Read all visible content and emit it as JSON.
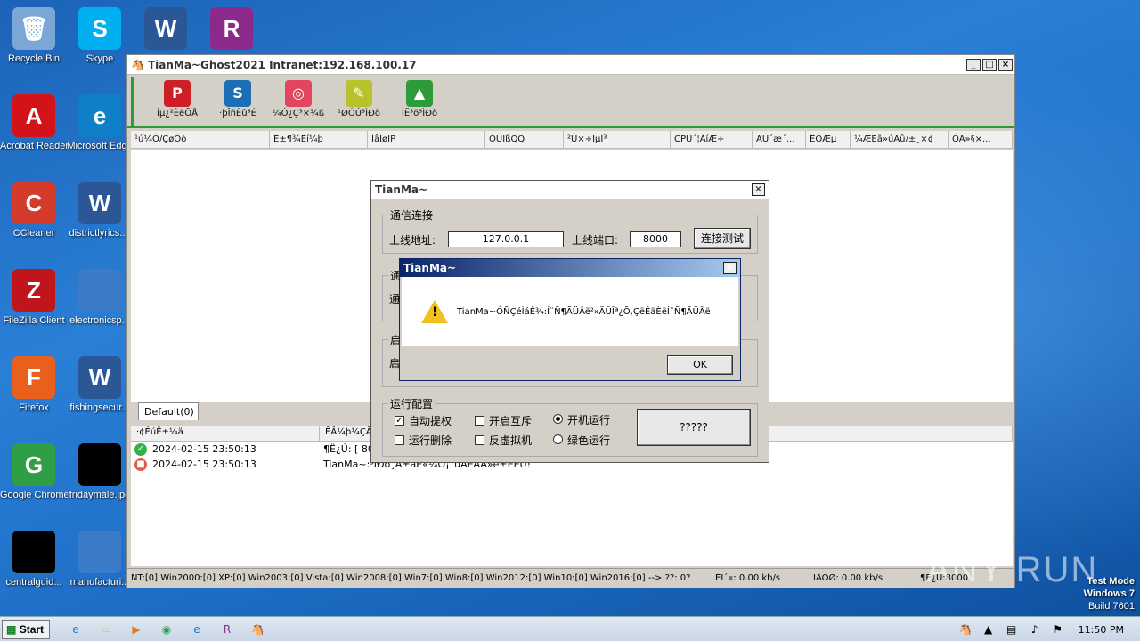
{
  "desktop": {
    "icons": [
      {
        "label": "Recycle Bin",
        "icon": "recycle-bin-icon",
        "color": "#7aa7d6",
        "glyph": "🗑"
      },
      {
        "label": "Skype",
        "icon": "skype-icon",
        "color": "#00aff0",
        "glyph": "S"
      },
      {
        "label": "",
        "icon": "word-doc-icon",
        "color": "#2b5797",
        "glyph": "W"
      },
      {
        "label": "",
        "icon": "winrar-icon",
        "color": "#8b2a8a",
        "glyph": "R"
      },
      {
        "label": "Acrobat Reader DC",
        "icon": "acrobat-icon",
        "color": "#d4121a",
        "glyph": "A"
      },
      {
        "label": "Microsoft Edge",
        "icon": "edge-icon",
        "color": "#0f7fc8",
        "glyph": "e"
      },
      {
        "label": "CCleaner",
        "icon": "ccleaner-icon",
        "color": "#d43b2a",
        "glyph": "C"
      },
      {
        "label": "districtlyrics....",
        "icon": "word-doc-icon",
        "color": "#2b5797",
        "glyph": "W"
      },
      {
        "label": "FileZilla Client",
        "icon": "filezilla-icon",
        "color": "#c0151b",
        "glyph": "Z"
      },
      {
        "label": "electronicsp...",
        "icon": "blank-file-icon",
        "color": "#3a7cc8",
        "glyph": ""
      },
      {
        "label": "Firefox",
        "icon": "firefox-icon",
        "color": "#e8601c",
        "glyph": "F"
      },
      {
        "label": "fishingsecur...",
        "icon": "word-doc-icon",
        "color": "#2b5797",
        "glyph": "W"
      },
      {
        "label": "Google Chrome",
        "icon": "chrome-icon",
        "color": "#2f9e44",
        "glyph": "G"
      },
      {
        "label": "fridaymale.jpg",
        "icon": "image-file-icon",
        "color": "#000000",
        "glyph": ""
      },
      {
        "label": "centralguid...",
        "icon": "image-file-icon",
        "color": "#000000",
        "glyph": ""
      },
      {
        "label": "manufacturi...",
        "icon": "blank-file-icon",
        "color": "#3a7cc8",
        "glyph": ""
      }
    ]
  },
  "mainwin": {
    "title": "TianMa~Ghost2021 Intranet:192.168.100.17",
    "tools": [
      {
        "label": "Ìµ¿²ÈëÕÅ",
        "icon": "pinterest-icon",
        "color": "#cc1f26",
        "glyph": "P"
      },
      {
        "label": "·þÎñÈû³É",
        "icon": "service-icon",
        "color": "#1c6fb5",
        "glyph": "S"
      },
      {
        "label": "¼Ó¿Ç³×¾ß",
        "icon": "basketball-icon",
        "color": "#e2455f",
        "glyph": "◎"
      },
      {
        "label": "¹ØÓÚ³ÌÐò",
        "icon": "edit-icon",
        "color": "#b8c22a",
        "glyph": "✎"
      },
      {
        "label": "ÍË³ö³ÌÐò",
        "icon": "exit-tree-icon",
        "color": "#2d9b3a",
        "glyph": "▲"
      }
    ],
    "columns": [
      "¹ú¼Ò/ÇøÓò",
      "É±¶¾Èí¼þ",
      "ÍâÍøIP",
      "ÔÚÏßQQ",
      "²Ù×÷ÏµÍ³",
      "CPU´¦ÀíÆ÷",
      "ÄÚ´æ´...",
      "ÊÓÆµ",
      "¼ÆËã»úÃû/±¸×¢",
      "ÓÃ»§×..."
    ],
    "tab": "Default(0)",
    "log_columns": [
      "·¢ÉúÊ±¼ä",
      "ÊÂ¼þ¼ÇÂ¼"
    ],
    "log_rows": [
      {
        "time": "2024-02-15 23:50:13",
        "text": "¶Ë¿Ú: [ 800",
        "status": "ok"
      },
      {
        "time": "2024-02-15 23:50:13",
        "text": "TianMa~:³ÌÐò¸Ä±äÈ«¼Õ¡¨ùÂÈÁÀ»ë±ËÈÛ!",
        "status": "warn"
      }
    ],
    "status": {
      "os_counts": "NT:[0] Win2000:[0] XP:[0] Win2003:[0] Vista:[0] Win2008:[0] Win7:[0] Win8:[0] Win2012:[0] Win10:[0] Win2016:[0] --> ??: 0?",
      "upload": "ÉÏ´«: 0.00 kb/s",
      "download": "ÏÂÔØ: 0.00 kb/s",
      "port": "¶Ë¿Ú:8000"
    }
  },
  "settings": {
    "title": "TianMa~",
    "group_conn": "通信连接",
    "addr_label": "上线地址:",
    "addr_value": "127.0.0.1",
    "port_label": "上线端口:",
    "port_value": "8000",
    "test_button": "连接测试",
    "group2_partial": "通",
    "group3_partial": "启",
    "group_run": "运行配置",
    "chk_autoelev": "自动提权",
    "chk_mutex": "开启互斥",
    "rad_autostart": "开机运行",
    "chk_runclean": "运行删除",
    "chk_antivm": "反虚拟机",
    "rad_green": "绿色运行",
    "generate_button": "?????"
  },
  "msgbox": {
    "title": "TianMa~",
    "text": "TianMa~ÓÑÇéÌáÊ¾:Í¨Ñ¶ÃÜÂë²»ÄÜÎª¿Õ,ÇëÊäÈëÍ¨Ñ¶ÃÜÂë",
    "ok": "OK"
  },
  "taskbar": {
    "start": "Start",
    "clock": "11:50 PM",
    "apps": [
      "ie-icon",
      "explorer-icon",
      "media-player-icon",
      "chrome-icon",
      "edge-icon",
      "winrar-icon",
      "tianma-icon"
    ]
  },
  "watermark": {
    "brand": "ANY RUN",
    "mode": "Test Mode",
    "os": "Windows 7",
    "build": "Build 7601"
  }
}
